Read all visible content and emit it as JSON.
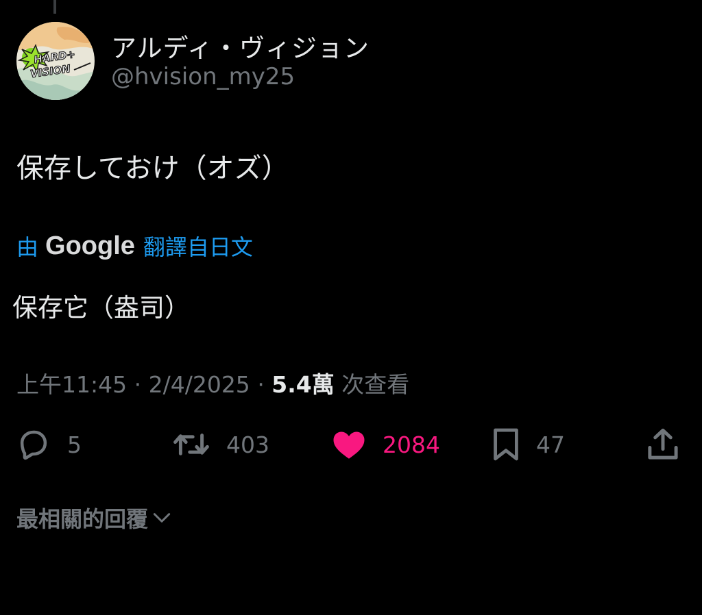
{
  "author": {
    "display_name": "アルディ・ヴィジョン",
    "handle": "@hvision_my25",
    "avatar_logo_text": "HARD+ VISION"
  },
  "tweet": {
    "text": "保存しておけ（オズ）"
  },
  "translation": {
    "prefix": "由",
    "provider": "Google",
    "suffix": "翻譯自日文",
    "text": "保存它（盎司）"
  },
  "meta": {
    "time": "上午11:45",
    "separator": "·",
    "date": "2/4/2025",
    "views_count": "5.4萬",
    "views_label": "次查看"
  },
  "actions": {
    "reply_count": "5",
    "retweet_count": "403",
    "like_count": "2084",
    "bookmark_count": "47",
    "liked": true
  },
  "replies_sort": {
    "label": "最相關的回覆"
  },
  "colors": {
    "background": "#000000",
    "primary_text": "#e7e9ea",
    "secondary_text": "#71767b",
    "link_blue": "#1d9bf0",
    "like_pink": "#f91880"
  },
  "icons": {
    "reply": "reply-icon",
    "retweet": "retweet-icon",
    "like": "heart-icon",
    "bookmark": "bookmark-icon",
    "share": "share-icon",
    "sort": "chevron-down-icon"
  }
}
